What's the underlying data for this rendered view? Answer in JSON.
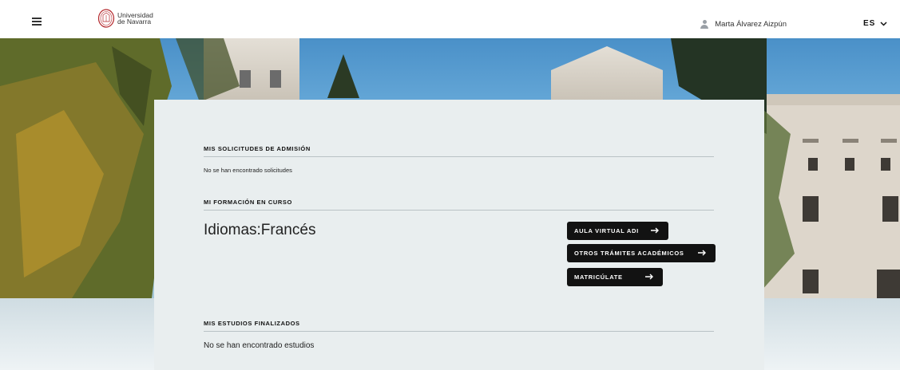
{
  "header": {
    "logo_line1": "Universidad",
    "logo_line2": "de Navarra",
    "user_name": "Marta Álvarez Aizpún",
    "language": "ES"
  },
  "sections": {
    "admissions": {
      "title": "MIS SOLICITUDES DE ADMISIÓN",
      "empty_text": "No se han encontrado solicitudes"
    },
    "current_training": {
      "title": "MI FORMACIÓN EN CURSO",
      "course_name": "Idiomas:Francés",
      "buttons": [
        {
          "label": "AULA VIRTUAL ADI"
        },
        {
          "label": "OTROS TRÁMITES ACADÉMICOS"
        },
        {
          "label": "MATRICÚLATE"
        }
      ]
    },
    "finished": {
      "title": "MIS ESTUDIOS FINALIZADOS",
      "empty_text": "No se han encontrado estudios"
    }
  },
  "icons": {
    "menu": "hamburger-icon",
    "user": "user-icon",
    "language_dropdown": "chevron-down-icon",
    "button_arrow": "arrow-right-icon",
    "logo": "university-seal"
  },
  "colors": {
    "button_bg": "#121212",
    "panel_bg": "#e9eeef",
    "brand_red": "#b3262b"
  }
}
